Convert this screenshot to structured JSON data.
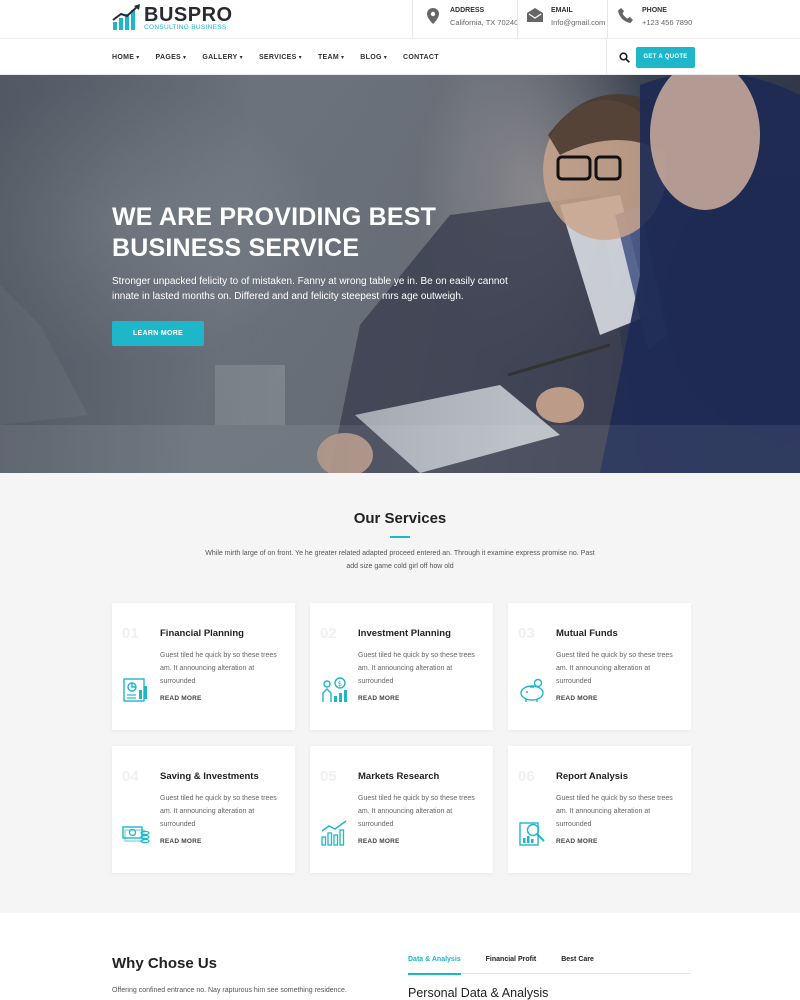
{
  "brand": {
    "name": "BUSPRO",
    "tagline": "CONSULTING BUSINESS"
  },
  "contacts": [
    {
      "label": "ADDRESS",
      "value": "California, TX 70240",
      "icon": "location-pin-icon"
    },
    {
      "label": "EMAIL",
      "value": "Info@gmail.com",
      "icon": "envelope-icon"
    },
    {
      "label": "PHONE",
      "value": "+123 456 7890",
      "icon": "phone-icon"
    }
  ],
  "nav": {
    "items": [
      {
        "label": "HOME",
        "dropdown": true
      },
      {
        "label": "PAGES",
        "dropdown": true
      },
      {
        "label": "GALLERY",
        "dropdown": true
      },
      {
        "label": "SERVICES",
        "dropdown": true
      },
      {
        "label": "TEAM",
        "dropdown": true
      },
      {
        "label": "BLOG",
        "dropdown": true
      },
      {
        "label": "CONTACT",
        "dropdown": false
      }
    ],
    "quote_label": "GET A QUOTE"
  },
  "hero": {
    "title_line1": "WE ARE PROVIDING BEST",
    "title_line2": "BUSINESS SERVICE",
    "text": "Stronger unpacked felicity to of mistaken. Fanny at wrong table ye in. Be on easily cannot innate in lasted months on. Differed and and felicity steepest mrs age outweigh.",
    "button_label": "LEARN MORE"
  },
  "services": {
    "title": "Our Services",
    "description": "While mirth large of on front. Ye he greater related adapted proceed entered an. Through it examine express promise no. Past add size game cold girl off how old",
    "cards": [
      {
        "num": "01",
        "title": "Financial Planning",
        "text": "Guest tiled he quick by so these trees am. It announcing alteration at surrounded",
        "more": "READ MORE",
        "icon": "financial-report-icon"
      },
      {
        "num": "02",
        "title": "Investment Planning",
        "text": "Guest tiled he quick by so these trees am. It announcing alteration at surrounded",
        "more": "READ MORE",
        "icon": "investment-growth-icon"
      },
      {
        "num": "03",
        "title": "Mutual Funds",
        "text": "Guest tiled he quick by so these trees am. It announcing alteration at surrounded",
        "more": "READ MORE",
        "icon": "piggy-bank-icon"
      },
      {
        "num": "04",
        "title": "Saving & Investments",
        "text": "Guest tiled he quick by so these trees am. It announcing alteration at surrounded",
        "more": "READ MORE",
        "icon": "money-coins-icon"
      },
      {
        "num": "05",
        "title": "Markets Research",
        "text": "Guest tiled he quick by so these trees am. It announcing alteration at surrounded",
        "more": "READ MORE",
        "icon": "bar-chart-growth-icon"
      },
      {
        "num": "06",
        "title": "Report Analysis",
        "text": "Guest tiled he quick by so these trees am. It announcing alteration at surrounded",
        "more": "READ MORE",
        "icon": "report-magnifier-icon"
      }
    ]
  },
  "why": {
    "title": "Why Chose Us",
    "text": "Offering confined entrance no. Nay rapturous him see something residence.",
    "tabs": [
      "Data & Analysis",
      "Financial Profit",
      "Best Care"
    ],
    "active_tab": "Data & Analysis",
    "panel_title": "Personal Data & Analysis"
  },
  "colors": {
    "accent": "#1eb7c9",
    "dark": "#2a2a35"
  }
}
